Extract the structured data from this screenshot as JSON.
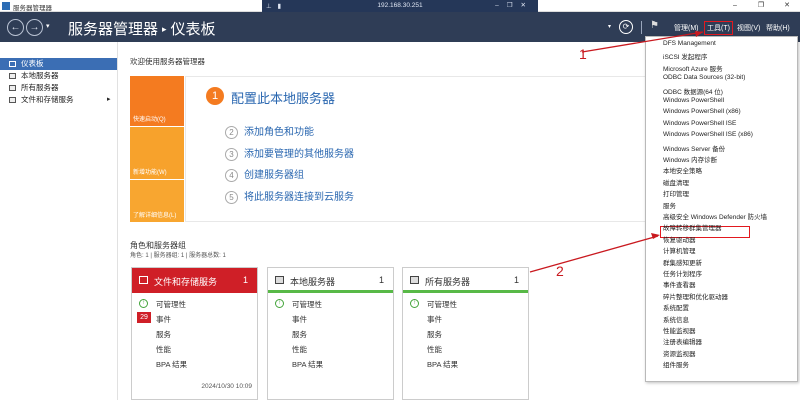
{
  "window": {
    "title": "服务器管理器",
    "remote_ip": "192.168.30.251"
  },
  "header": {
    "breadcrumb_app": "服务器管理器",
    "breadcrumb_sep": "▸",
    "breadcrumb_page": "仪表板",
    "menus": {
      "manage": "管理(M)",
      "tools": "工具(T)",
      "view": "视图(V)",
      "help": "帮助(H)"
    }
  },
  "sidebar": {
    "items": [
      {
        "label": "仪表板",
        "icon": "dashboard-icon",
        "selected": true
      },
      {
        "label": "本地服务器",
        "icon": "server-icon",
        "selected": false
      },
      {
        "label": "所有服务器",
        "icon": "servers-icon",
        "selected": false
      },
      {
        "label": "文件和存储服务",
        "icon": "storage-icon",
        "selected": false,
        "chevron": "▸"
      }
    ]
  },
  "welcome": {
    "title": "欢迎使用服务器管理器",
    "quick_tiles": [
      "快速启动(Q)",
      "新增功能(W)",
      "了解详细信息(L)"
    ],
    "main_step": {
      "num": "1",
      "label": "配置此本地服务器"
    },
    "steps": [
      {
        "num": "2",
        "label": "添加角色和功能"
      },
      {
        "num": "3",
        "label": "添加要管理的其他服务器"
      },
      {
        "num": "4",
        "label": "创建服务器组"
      },
      {
        "num": "5",
        "label": "将此服务器连接到云服务"
      }
    ]
  },
  "roles": {
    "title": "角色和服务器组",
    "subtitle": "角色: 1 | 服务器组: 1 | 服务器总数: 1",
    "tiles": [
      {
        "name": "文件和存储服务",
        "count": "1",
        "alert": true,
        "rows": [
          "可管理性",
          "事件",
          "服务",
          "性能",
          "BPA 结果"
        ],
        "event_badge": "29",
        "timestamp": "2024/10/30 10:09"
      },
      {
        "name": "本地服务器",
        "count": "1",
        "alert": false,
        "rows": [
          "可管理性",
          "事件",
          "服务",
          "性能",
          "BPA 结果"
        ]
      },
      {
        "name": "所有服务器",
        "count": "1",
        "alert": false,
        "rows": [
          "可管理性",
          "事件",
          "服务",
          "性能",
          "BPA 结果"
        ]
      }
    ]
  },
  "tools_menu": {
    "items": [
      "DFS Management",
      "iSCSI 发起程序",
      "Microsoft Azure 服务",
      "ODBC Data Sources (32-bit)",
      "ODBC 数据源(64 位)",
      "Windows PowerShell",
      "Windows PowerShell (x86)",
      "Windows PowerShell ISE",
      "Windows PowerShell ISE (x86)",
      "Windows Server 备份",
      "Windows 内存诊断",
      "本地安全策略",
      "磁盘清理",
      "打印管理",
      "服务",
      "高级安全 Windows Defender 防火墙",
      "故障转移群集管理器",
      "恢复驱动器",
      "计算机管理",
      "群集感知更新",
      "任务计划程序",
      "事件查看器",
      "碎片整理和优化驱动器",
      "系统配置",
      "系统信息",
      "性能监视器",
      "注册表编辑器",
      "资源监视器",
      "组件服务"
    ],
    "highlighted_index": 16
  },
  "annotations": {
    "label_1": "1",
    "label_2": "2",
    "color": "#c9191f"
  },
  "colors": {
    "header_bg": "#2f3d56",
    "selected": "#3b6eb4",
    "orange": "#f47b20",
    "alert_red": "#cf1f27",
    "ok_green": "#58b947"
  }
}
